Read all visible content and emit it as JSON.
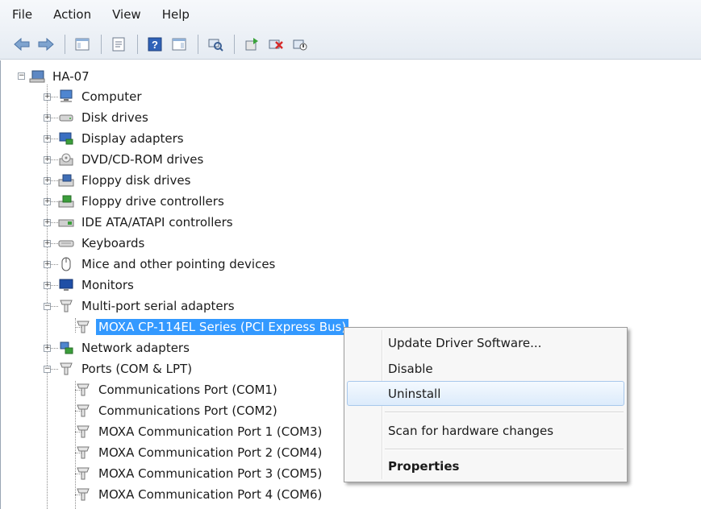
{
  "menu": [
    "File",
    "Action",
    "View",
    "Help"
  ],
  "toolbar": {
    "icons": [
      "back-arrow-icon",
      "forward-arrow-icon",
      "show-hide-console-tree-icon",
      "properties-icon",
      "help-icon",
      "show-action-pane-icon",
      "scan-hardware-icon",
      "update-driver-icon",
      "uninstall-icon",
      "disable-device-icon"
    ]
  },
  "tree": {
    "root": "HA-07",
    "items": [
      {
        "label": "Computer"
      },
      {
        "label": "Disk drives"
      },
      {
        "label": "Display adapters"
      },
      {
        "label": "DVD/CD-ROM drives"
      },
      {
        "label": "Floppy disk drives"
      },
      {
        "label": "Floppy drive controllers"
      },
      {
        "label": "IDE ATA/ATAPI controllers"
      },
      {
        "label": "Keyboards"
      },
      {
        "label": "Mice and other pointing devices"
      },
      {
        "label": "Monitors"
      },
      {
        "label": "Multi-port serial adapters"
      },
      {
        "label": "MOXA CP-114EL Series (PCI Express Bus)"
      },
      {
        "label": "Network adapters"
      },
      {
        "label": "Ports (COM & LPT)"
      },
      {
        "label": "Communications Port (COM1)"
      },
      {
        "label": "Communications Port (COM2)"
      },
      {
        "label": "MOXA Communication Port 1 (COM3)"
      },
      {
        "label": "MOXA Communication Port 2 (COM4)"
      },
      {
        "label": "MOXA Communication Port 3 (COM5)"
      },
      {
        "label": "MOXA Communication Port 4 (COM6)"
      }
    ]
  },
  "context_menu": {
    "update": "Update Driver Software...",
    "disable": "Disable",
    "uninstall": "Uninstall",
    "scan": "Scan for hardware changes",
    "properties": "Properties"
  },
  "colors": {
    "selection": "#3399ff",
    "menu_hover": "#dcebfb"
  }
}
